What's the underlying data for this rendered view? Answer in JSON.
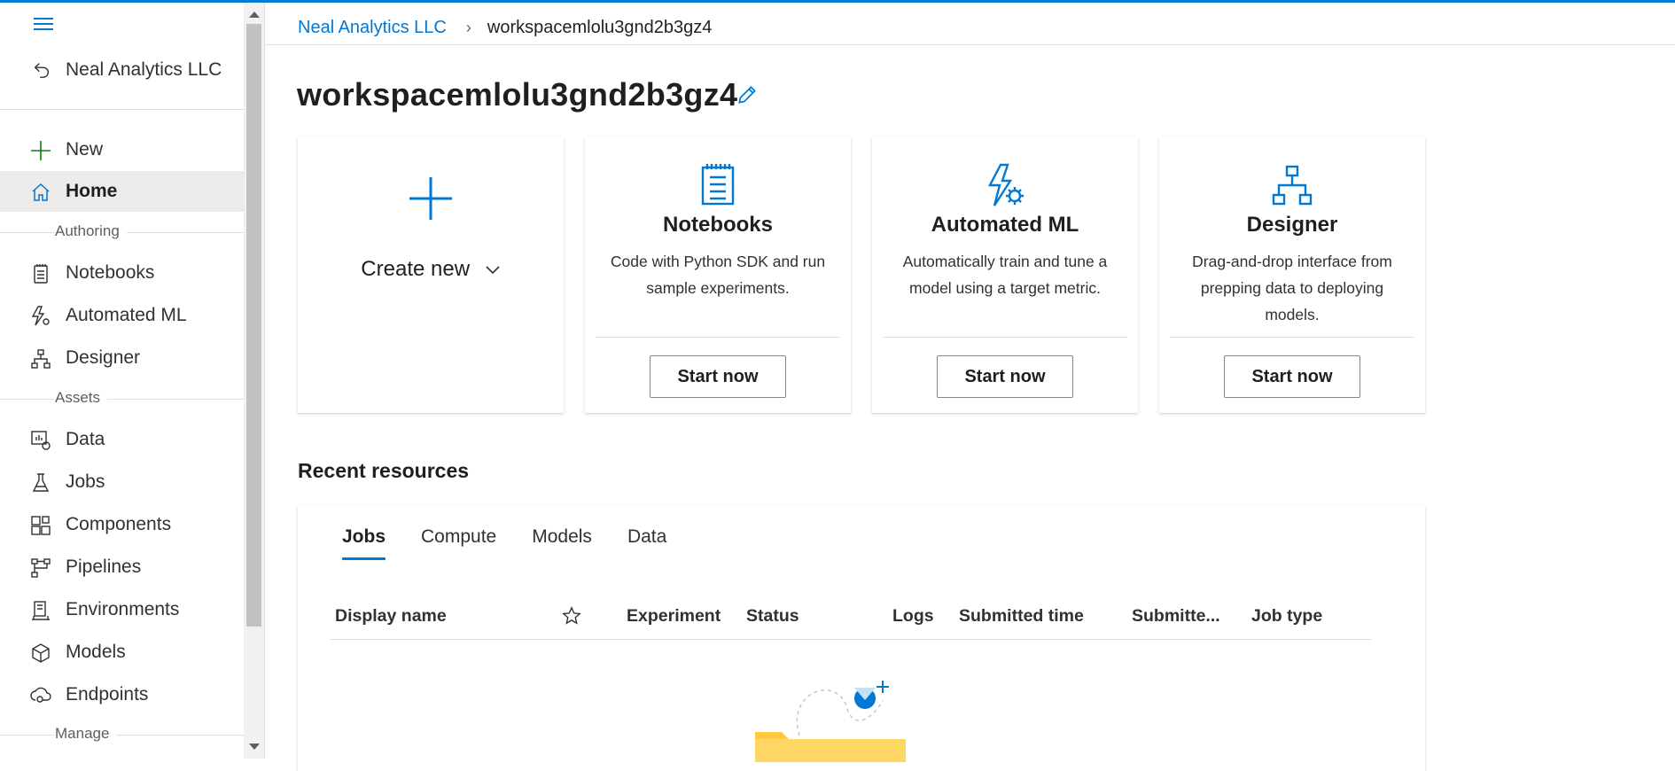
{
  "app": {
    "accent": "#0078d4"
  },
  "sidebar": {
    "back_label": "Neal Analytics LLC",
    "items_top": [
      {
        "label": "New",
        "icon": "plus-icon"
      },
      {
        "label": "Home",
        "icon": "home-icon",
        "active": true
      }
    ],
    "sections": [
      {
        "label": "Authoring",
        "items": [
          {
            "label": "Notebooks",
            "icon": "notebook-icon"
          },
          {
            "label": "Automated ML",
            "icon": "automl-icon"
          },
          {
            "label": "Designer",
            "icon": "designer-icon"
          }
        ]
      },
      {
        "label": "Assets",
        "items": [
          {
            "label": "Data",
            "icon": "data-icon"
          },
          {
            "label": "Jobs",
            "icon": "flask-icon"
          },
          {
            "label": "Components",
            "icon": "components-icon"
          },
          {
            "label": "Pipelines",
            "icon": "pipeline-icon"
          },
          {
            "label": "Environments",
            "icon": "environment-icon"
          },
          {
            "label": "Models",
            "icon": "cube-icon"
          },
          {
            "label": "Endpoints",
            "icon": "endpoint-icon"
          }
        ]
      },
      {
        "label": "Manage",
        "items": []
      }
    ]
  },
  "breadcrumb": {
    "parent": "Neal Analytics LLC",
    "current": "workspacemlolu3gnd2b3gz4"
  },
  "page": {
    "title": "workspacemlolu3gnd2b3gz4"
  },
  "cards": {
    "create_new": {
      "label": "Create new"
    },
    "notebooks": {
      "title": "Notebooks",
      "description": "Code with Python SDK and run sample experiments.",
      "button": "Start now"
    },
    "automl": {
      "title": "Automated ML",
      "description": "Automatically train and tune a model using a target metric.",
      "button": "Start now"
    },
    "designer": {
      "title": "Designer",
      "description": "Drag-and-drop interface from prepping data to deploying models.",
      "button": "Start now"
    }
  },
  "recent": {
    "title": "Recent resources",
    "tabs": [
      "Jobs",
      "Compute",
      "Models",
      "Data"
    ],
    "active_tab": "Jobs",
    "columns": [
      "Display name",
      "Experiment",
      "Status",
      "Logs",
      "Submitted time",
      "Submitte...",
      "Job type"
    ]
  }
}
